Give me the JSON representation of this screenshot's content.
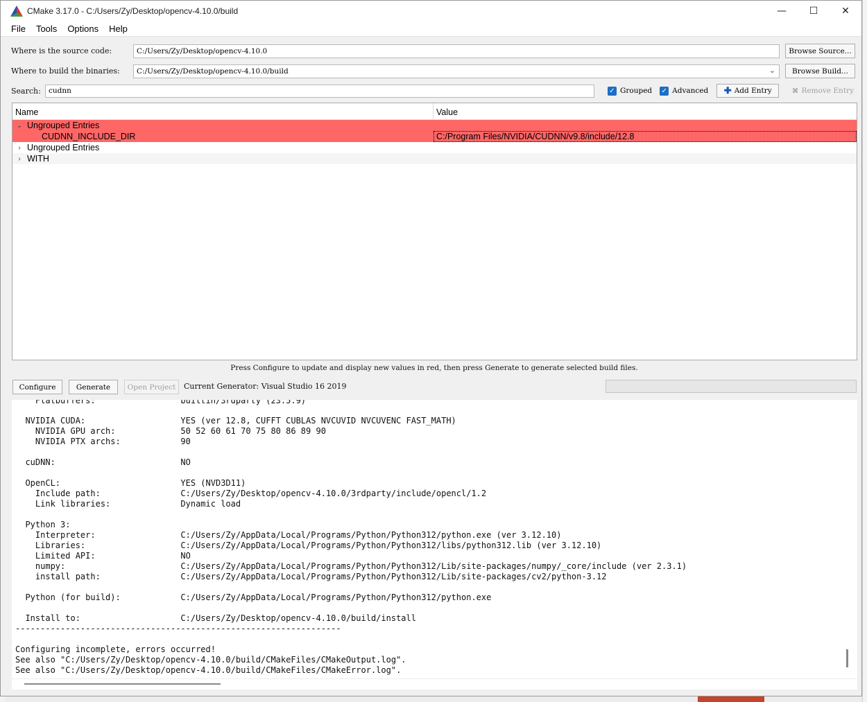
{
  "window": {
    "title": "CMake 3.17.0 - C:/Users/Zy/Desktop/opencv-4.10.0/build",
    "controls": {
      "minimize": "—",
      "maximize": "☐",
      "close": "✕"
    }
  },
  "menu": {
    "items": [
      "File",
      "Tools",
      "Options",
      "Help"
    ]
  },
  "source": {
    "label": "Where is the source code:",
    "value": "C:/Users/Zy/Desktop/opencv-4.10.0",
    "browse": "Browse Source..."
  },
  "build": {
    "label": "Where to build the binaries:",
    "value": "C:/Users/Zy/Desktop/opencv-4.10.0/build",
    "browse": "Browse Build..."
  },
  "search": {
    "label": "Search:",
    "value": "cudnn",
    "grouped_label": "Grouped",
    "grouped_checked": true,
    "advanced_label": "Advanced",
    "advanced_checked": true,
    "add_entry": "Add Entry",
    "remove_entry": "Remove Entry"
  },
  "tree": {
    "headers": {
      "name": "Name",
      "value": "Value"
    },
    "rows": [
      {
        "expanded": true,
        "name": "Ungrouped Entries",
        "value": "",
        "highlight": true,
        "level": 0
      },
      {
        "name": "CUDNN_INCLUDE_DIR",
        "value": "C:/Program Files/NVIDIA/CUDNN/v9.8/include/12.8",
        "highlight": true,
        "level": 1
      },
      {
        "expanded": false,
        "name": "Ungrouped Entries",
        "value": "",
        "highlight": false,
        "level": 0
      },
      {
        "expanded": false,
        "name": "WITH",
        "value": "",
        "highlight": false,
        "level": 0
      }
    ]
  },
  "status_message": "Press Configure to update and display new values in red, then press Generate to generate selected build files.",
  "actions": {
    "configure": "Configure",
    "generate": "Generate",
    "open_project": "Open Project",
    "generator_label": "Current Generator: Visual Studio 16 2019"
  },
  "log": [
    "    Flatbuffers:                 builtin/3rdparty (23.5.9)",
    "",
    "  NVIDIA CUDA:                   YES (ver 12.8, CUFFT CUBLAS NVCUVID NVCUVENC FAST_MATH)",
    "    NVIDIA GPU arch:             50 52 60 61 70 75 80 86 89 90",
    "    NVIDIA PTX archs:            90",
    "",
    "  cuDNN:                         NO",
    "",
    "  OpenCL:                        YES (NVD3D11)",
    "    Include path:                C:/Users/Zy/Desktop/opencv-4.10.0/3rdparty/include/opencl/1.2",
    "    Link libraries:              Dynamic load",
    "",
    "  Python 3:",
    "    Interpreter:                 C:/Users/Zy/AppData/Local/Programs/Python/Python312/python.exe (ver 3.12.10)",
    "    Libraries:                   C:/Users/Zy/AppData/Local/Programs/Python/Python312/libs/python312.lib (ver 3.12.10)",
    "    Limited API:                 NO",
    "    numpy:                       C:/Users/Zy/AppData/Local/Programs/Python/Python312/Lib/site-packages/numpy/_core/include (ver 2.3.1)",
    "    install path:                C:/Users/Zy/AppData/Local/Programs/Python/Python312/Lib/site-packages/cv2/python-3.12",
    "",
    "  Python (for build):            C:/Users/Zy/AppData/Local/Programs/Python/Python312/python.exe",
    "",
    "  Install to:                    C:/Users/Zy/Desktop/opencv-4.10.0/build/install",
    "-----------------------------------------------------------------",
    "",
    "Configuring incomplete, errors occurred!",
    "See also \"C:/Users/Zy/Desktop/opencv-4.10.0/build/CMakeFiles/CMakeOutput.log\".",
    "See also \"C:/Users/Zy/Desktop/opencv-4.10.0/build/CMakeFiles/CMakeError.log\"."
  ],
  "colors": {
    "highlight_red": "#ff6666",
    "checkbox_blue": "#1d6ec5"
  }
}
